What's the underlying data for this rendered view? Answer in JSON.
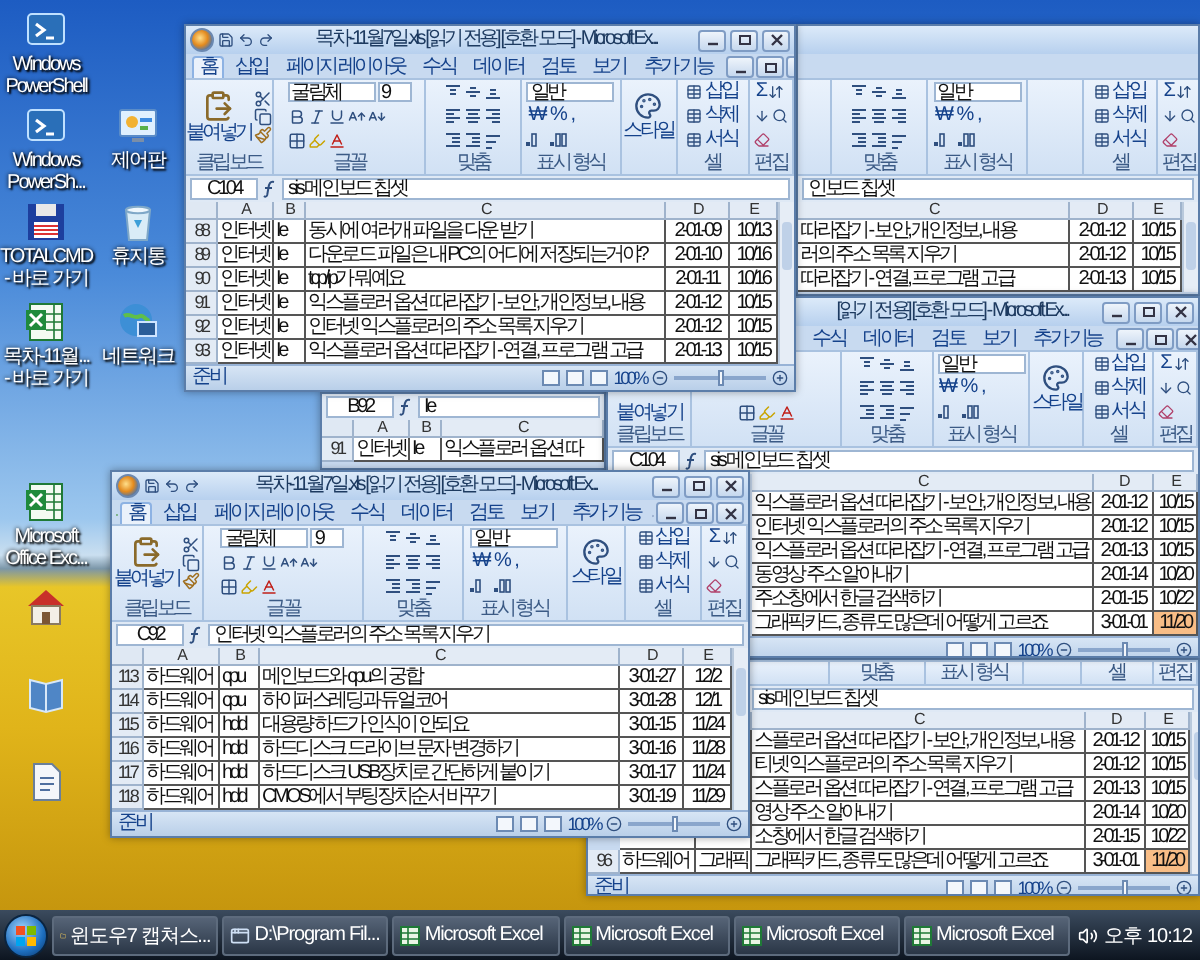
{
  "desktop_icons": [
    {
      "label": "Windows PowerShell",
      "kind": "terminal"
    },
    {
      "label": "Windows PowerSh...",
      "kind": "terminal"
    },
    {
      "label": "제어판",
      "kind": "control"
    },
    {
      "label": "TOTALCMD - 바로 가기",
      "kind": "floppy"
    },
    {
      "label": "휴지통",
      "kind": "recycle"
    },
    {
      "label": "목차-11월... - 바로 가기",
      "kind": "sheet"
    },
    {
      "label": "네트워크",
      "kind": "network"
    },
    {
      "label": "Microsoft Office Exc...",
      "kind": "sheet"
    },
    {
      "kind": "house"
    },
    {
      "kind": "book"
    },
    {
      "kind": "document"
    }
  ],
  "windows": [
    {
      "title": "목차-11월7일.xls [읽기 전용] [호환 모드] - Microsoft Ex...",
      "tabs": [
        {
          "label": "홈",
          "selected": true
        },
        {
          "label": "삽입",
          "selected": false
        },
        {
          "label": "페이지 레이아웃",
          "selected": false
        },
        {
          "label": "수식",
          "selected": false
        },
        {
          "label": "데이터",
          "selected": false
        },
        {
          "label": "검토",
          "selected": false
        },
        {
          "label": "보기",
          "selected": false
        },
        {
          "label": "추가 기능",
          "selected": false
        }
      ],
      "ribbon": [
        {
          "kind": "clipboard",
          "label": "클립보드",
          "paste": "붙여넣기"
        },
        {
          "kind": "font",
          "label": "글꼴",
          "font": "굴림체",
          "size": "9"
        },
        {
          "kind": "alignment",
          "label": "맞춤"
        },
        {
          "kind": "number",
          "label": "표시 형식",
          "format": "일반",
          "buttons": [
            "₩",
            "%",
            ","
          ]
        },
        {
          "kind": "styles",
          "text": "스타일"
        },
        {
          "kind": "cells",
          "label": "셀",
          "items": [
            "삽입",
            "삭제",
            "서식"
          ]
        },
        {
          "kind": "editing",
          "label": "편집",
          "sum": "Σ"
        }
      ],
      "formula": {
        "cell": "C104",
        "text": "sis 메인보드 칩셋"
      },
      "columns": [
        "A",
        "B",
        "C",
        "D",
        "E"
      ],
      "rows": [
        {
          "number": "88",
          "cells": [
            "인터넷",
            "Ie",
            "동시에 여러개 파일을 다운 받기",
            "2-01-09",
            "10/13"
          ],
          "flagged": false
        },
        {
          "number": "89",
          "cells": [
            "인터넷",
            "Ie",
            "다운로드 파일은 내 PC의 어디에 저장되는거야?",
            "2-01-10",
            "10/16"
          ],
          "flagged": false
        },
        {
          "number": "90",
          "cells": [
            "인터넷",
            "Ie",
            "tcp/ip가 뭐예요",
            "2-01-11",
            "10/16"
          ],
          "flagged": false
        },
        {
          "number": "91",
          "cells": [
            "인터넷",
            "Ie",
            "익스플로러 옵션 따라잡기 - 보안, 개인정보, 내용",
            "2-01-12",
            "10/15"
          ],
          "flagged": false
        },
        {
          "number": "92",
          "cells": [
            "인터넷",
            "Ie",
            "인터넷 익스플로러의 주소 목록 지우기",
            "2-01-12",
            "10/15"
          ],
          "flagged": false
        },
        {
          "number": "93",
          "cells": [
            "인터넷",
            "Ie",
            "익스플로러 옵션 따라잡기 - 연결, 프로그램 고급",
            "2-01-13",
            "10/15"
          ],
          "flagged": false
        }
      ],
      "status": {
        "text": "준비",
        "zoom": "100%",
        "level": 0.5
      }
    },
    {
      "ribbon": [
        {
          "kind": "alignment",
          "label": "맞춤"
        },
        {
          "kind": "number",
          "label": "표시 형식",
          "format": "일반",
          "buttons": [
            "₩",
            "%",
            ","
          ]
        },
        {
          "kind": "cells",
          "label": "셀",
          "items": [
            "삽입",
            "삭제",
            "서식"
          ]
        },
        {
          "kind": "editing",
          "label": "편집",
          "sum": "Σ"
        }
      ],
      "formula": {
        "text": "인보드 칩셋"
      },
      "columns": [
        "C",
        "D",
        "E"
      ],
      "rows": [
        {
          "cells": [
            "따라잡기 - 보안, 개인정보, 내용",
            "2-01-12",
            "10/15"
          ],
          "flagged": false
        },
        {
          "cells": [
            "러의 주소 목록 지우기",
            "2-01-12",
            "10/15"
          ],
          "flagged": false
        },
        {
          "cells": [
            "따라잡기 - 연결, 프로그램 고급",
            "2-01-13",
            "10/15"
          ],
          "flagged": false
        }
      ]
    },
    {
      "formula": {
        "cell": "B92",
        "text": "Ie"
      },
      "columns": [
        "A",
        "B",
        "C"
      ],
      "rows": [
        {
          "number": "91",
          "cells": [
            "인터넷",
            "Ie",
            "익스플로러 옵션 따"
          ]
        }
      ]
    },
    {
      "title": "[읽기 전용] [호환 모드] - Microsoft Ex...",
      "tabs": [
        {
          "label": "수식",
          "selected": false
        },
        {
          "label": "데이터",
          "selected": false
        },
        {
          "label": "검토",
          "selected": false
        },
        {
          "label": "보기",
          "selected": false
        },
        {
          "label": "추가 기능",
          "selected": false
        }
      ],
      "ribbon": [
        {
          "kind": "clipboard",
          "label": "클립보드",
          "paste": "붙여넣기"
        },
        {
          "kind": "font",
          "label": "글꼴"
        },
        {
          "kind": "alignment",
          "label": "맞춤"
        },
        {
          "kind": "number",
          "label": "표시 형식",
          "format": "일반",
          "buttons": [
            "₩",
            "%",
            ","
          ]
        },
        {
          "kind": "styles",
          "text": "스타일"
        },
        {
          "kind": "cells",
          "label": "셀",
          "items": [
            "삽입",
            "삭제",
            "서식"
          ]
        },
        {
          "kind": "editing",
          "label": "편집",
          "sum": "Σ"
        }
      ],
      "formula": {
        "cell": "C104",
        "text": "sis 메인보드 칩셋"
      },
      "columns": [
        "C",
        "D",
        "E"
      ],
      "rows": [
        {
          "cells": [
            "익스플로러 옵션 따라잡기 - 보안, 개인정보, 내용",
            "2-01-12",
            "10/15"
          ],
          "flagged": false
        },
        {
          "cells": [
            "인터넷 익스플로러의 주소 목록 지우기",
            "2-01-12",
            "10/15"
          ],
          "flagged": false
        },
        {
          "cells": [
            "익스플로러 옵션 따라잡기 - 연결, 프로그램 고급",
            "2-01-13",
            "10/15"
          ],
          "flagged": false
        },
        {
          "cells": [
            "동영상 주소 알아내기",
            "2-01-14",
            "10/20"
          ],
          "flagged": false
        },
        {
          "cells": [
            "주소창에서 한글 검색하기",
            "2-01-15",
            "10/22"
          ],
          "flagged": false
        },
        {
          "cells": [
            "그래픽카드, 종류도 많은데 어떻게 고르죠",
            "3-01-01",
            "11/20"
          ],
          "flagged": true
        }
      ],
      "status": {
        "zoom": "100%",
        "level": 0.5
      }
    },
    {
      "title": "목차-11월7일.xls [읽기 전용] [호환 모드] - Microsoft Ex...",
      "tabs": [
        {
          "label": "홈",
          "selected": true
        },
        {
          "label": "삽입",
          "selected": false
        },
        {
          "label": "페이지 레이아웃",
          "selected": false
        },
        {
          "label": "수식",
          "selected": false
        },
        {
          "label": "데이터",
          "selected": false
        },
        {
          "label": "검토",
          "selected": false
        },
        {
          "label": "보기",
          "selected": false
        },
        {
          "label": "추가 기능",
          "selected": false
        }
      ],
      "ribbon": [
        {
          "kind": "clipboard",
          "label": "클립보드",
          "paste": "붙여넣기"
        },
        {
          "kind": "font",
          "label": "글꼴",
          "font": "굴림체",
          "size": "9"
        },
        {
          "kind": "alignment",
          "label": "맞춤"
        },
        {
          "kind": "number",
          "label": "표시 형식",
          "format": "일반",
          "buttons": [
            "₩",
            "%",
            ","
          ]
        },
        {
          "kind": "styles",
          "text": "스타일"
        },
        {
          "kind": "cells",
          "label": "셀",
          "items": [
            "삽입",
            "삭제",
            "서식"
          ]
        },
        {
          "kind": "editing",
          "label": "편집",
          "sum": "Σ"
        }
      ],
      "formula": {
        "cell": "C92",
        "text": "인터넷 익스플로러의 주소 목록 지우기"
      },
      "columns": [
        "A",
        "B",
        "C",
        "D",
        "E"
      ],
      "rows": [
        {
          "number": "113",
          "cells": [
            "하드웨어",
            "cpu",
            "메인보드와 cpu의 궁합",
            "3-01-27",
            "12/2"
          ],
          "flagged": false
        },
        {
          "number": "114",
          "cells": [
            "하드웨어",
            "cpu",
            "하이퍼스레딩과 듀얼코어",
            "3-01-28",
            "12/1"
          ],
          "flagged": false
        },
        {
          "number": "115",
          "cells": [
            "하드웨어",
            "hdd",
            "대용량 하드가 인식이 안되요",
            "3-01-15",
            "11/24"
          ],
          "flagged": false
        },
        {
          "number": "116",
          "cells": [
            "하드웨어",
            "hdd",
            "하드디스크 드라이브 문자 변경하기",
            "3-01-16",
            "11/28"
          ],
          "flagged": false
        },
        {
          "number": "117",
          "cells": [
            "하드웨어",
            "hdd",
            "하드디스크 USB장치로 간단하게 붙이기",
            "3-01-17",
            "11/24"
          ],
          "flagged": false
        },
        {
          "number": "118",
          "cells": [
            "하드웨어",
            "hdd",
            "CMOS에서 부팅장치순서 바꾸기",
            "3-01-19",
            "11/29"
          ],
          "flagged": false
        }
      ],
      "status": {
        "text": "준비",
        "zoom": "100%",
        "level": 0.5
      }
    },
    {
      "ribbon": [
        {
          "kind": "alignment",
          "label": "맞춤"
        },
        {
          "kind": "number",
          "label": "표시 형식"
        },
        {
          "kind": "cells",
          "label": "셀"
        },
        {
          "kind": "editing",
          "label": "편집"
        }
      ],
      "formula": {
        "text": "sis 메인보드 칩셋"
      },
      "columns": [
        null,
        null,
        "C",
        "D",
        "E"
      ],
      "rows": [
        {
          "cells": [
            null,
            null,
            "스플로러 옵션 따라잡기 - 보안, 개인정보, 내용",
            "2-01-12",
            "10/15"
          ],
          "flagged": false
        },
        {
          "cells": [
            null,
            null,
            "티넷 익스플로러의 주소 목록 지우기",
            "2-01-12",
            "10/15"
          ],
          "flagged": false
        },
        {
          "cells": [
            null,
            null,
            "스플로러 옵션 따라잡기 - 연결, 프로그램 고급",
            "2-01-13",
            "10/15"
          ],
          "flagged": false
        },
        {
          "cells": [
            null,
            null,
            "영상 주소 알아내기",
            "2-01-14",
            "10/20"
          ],
          "flagged": false
        },
        {
          "cells": [
            null,
            null,
            "소창에서 한글 검색하기",
            "2-01-15",
            "10/22"
          ],
          "flagged": false
        },
        {
          "number": "96",
          "cells": [
            "하드웨어",
            "그래픽",
            "그래픽카드, 종류도 많은데 어떻게 고르죠",
            "3-01-01",
            "11/20"
          ],
          "flagged": true
        }
      ],
      "status": {
        "text": "준비",
        "zoom": "100%",
        "level": 0.5
      }
    }
  ],
  "taskbar": {
    "items": [
      {
        "label": "윈도우7 캡쳐스...",
        "kind": "folder"
      },
      {
        "label": "D:\\Program Fil...",
        "kind": "window"
      },
      {
        "label": "Microsoft Excel",
        "kind": "sheet"
      },
      {
        "label": "Microsoft Excel",
        "kind": "sheet"
      },
      {
        "label": "Microsoft Excel",
        "kind": "sheet"
      },
      {
        "label": "Microsoft Excel",
        "kind": "sheet"
      }
    ],
    "clock": "오후 10:12"
  }
}
